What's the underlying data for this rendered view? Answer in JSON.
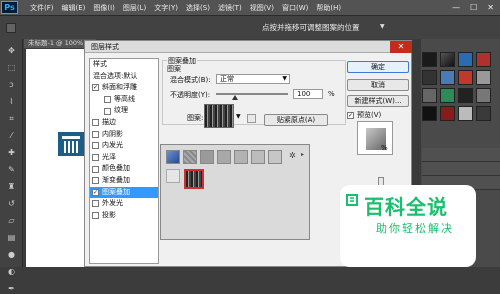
{
  "app": {
    "logo": "Ps",
    "menu": [
      "文件(F)",
      "编辑(E)",
      "图像(I)",
      "图层(L)",
      "文字(Y)",
      "选择(S)",
      "滤镜(T)",
      "视图(V)",
      "窗口(W)",
      "帮助(H)"
    ],
    "window_controls": [
      "—",
      "☐",
      "✕"
    ]
  },
  "options_bar": {
    "hint": "点按并拖移可调整图案的位置",
    "dropdown_caret": "▼"
  },
  "document": {
    "tab_title": "未标题-1 @ 100%"
  },
  "dialog": {
    "title": "图层样式",
    "close": "✕",
    "style_list": {
      "header": "样式",
      "items": [
        {
          "label": "混合选项:默认",
          "checkbox": false,
          "checked": false,
          "indent": false,
          "selected": false
        },
        {
          "label": "斜面和浮雕",
          "checkbox": true,
          "checked": true,
          "indent": false,
          "selected": false
        },
        {
          "label": "等高线",
          "checkbox": true,
          "checked": false,
          "indent": true,
          "selected": false
        },
        {
          "label": "纹理",
          "checkbox": true,
          "checked": false,
          "indent": true,
          "selected": false
        },
        {
          "label": "描边",
          "checkbox": true,
          "checked": false,
          "indent": false,
          "selected": false
        },
        {
          "label": "内阴影",
          "checkbox": true,
          "checked": false,
          "indent": false,
          "selected": false
        },
        {
          "label": "内发光",
          "checkbox": true,
          "checked": false,
          "indent": false,
          "selected": false
        },
        {
          "label": "光泽",
          "checkbox": true,
          "checked": false,
          "indent": false,
          "selected": false
        },
        {
          "label": "颜色叠加",
          "checkbox": true,
          "checked": false,
          "indent": false,
          "selected": false
        },
        {
          "label": "渐变叠加",
          "checkbox": true,
          "checked": false,
          "indent": false,
          "selected": false
        },
        {
          "label": "图案叠加",
          "checkbox": true,
          "checked": true,
          "indent": false,
          "selected": true
        },
        {
          "label": "外发光",
          "checkbox": true,
          "checked": false,
          "indent": false,
          "selected": false
        },
        {
          "label": "投影",
          "checkbox": true,
          "checked": false,
          "indent": false,
          "selected": false
        }
      ]
    },
    "panel": {
      "group_title": "图案叠加",
      "sub_title": "图案",
      "blend_mode_label": "混合模式(B):",
      "blend_mode_value": "正常",
      "opacity_label": "不透明度(Y):",
      "opacity_value": "100",
      "opacity_unit": "%",
      "pattern_label": "图案:",
      "snap_origin_label": "贴紧原点(A)",
      "side_unit": "%"
    },
    "buttons": {
      "ok": "确定",
      "cancel": "取消",
      "new_style": "新建样式(W)...",
      "preview_label": "预览(V)",
      "preview_checked": true
    },
    "picker": {
      "gear": "✲",
      "arrow": "▸"
    }
  },
  "watermark": {
    "title": "百科全说",
    "subtitle": "助你轻松解决"
  },
  "colors": {
    "accent": "#3399ff",
    "watermark_green": "#19c06c",
    "dialog_bg": "#f0f0f0",
    "app_bg": "#3c3c3c"
  }
}
